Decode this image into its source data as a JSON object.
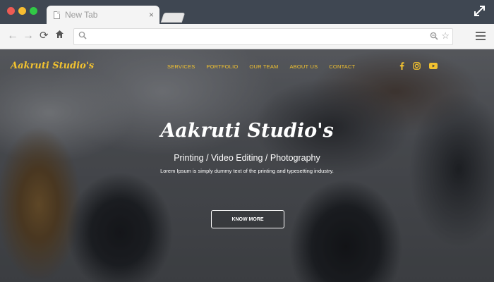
{
  "browser": {
    "tab_title": "New Tab",
    "tab_close": "×",
    "address_placeholder": "",
    "colors": {
      "chrome_dark": "#3f4752",
      "toolbar": "#f4f4f4"
    }
  },
  "site": {
    "brand": "Aakruti Studio's",
    "nav": [
      "SERVICES",
      "PORTFOLIO",
      "OUR TEAM",
      "ABOUT US",
      "CONTACT"
    ],
    "social_icons": [
      "facebook-icon",
      "instagram-icon",
      "youtube-icon"
    ],
    "hero": {
      "title": "Aakruti Studio's",
      "subtitle": "Printing / Video Editing / Photography",
      "description": "Lorem Ipsum is simply dummy text of the printing and typesetting industry.",
      "cta": "KNOW MORE"
    },
    "colors": {
      "accent": "#f2c230",
      "text": "#ffffff"
    }
  }
}
